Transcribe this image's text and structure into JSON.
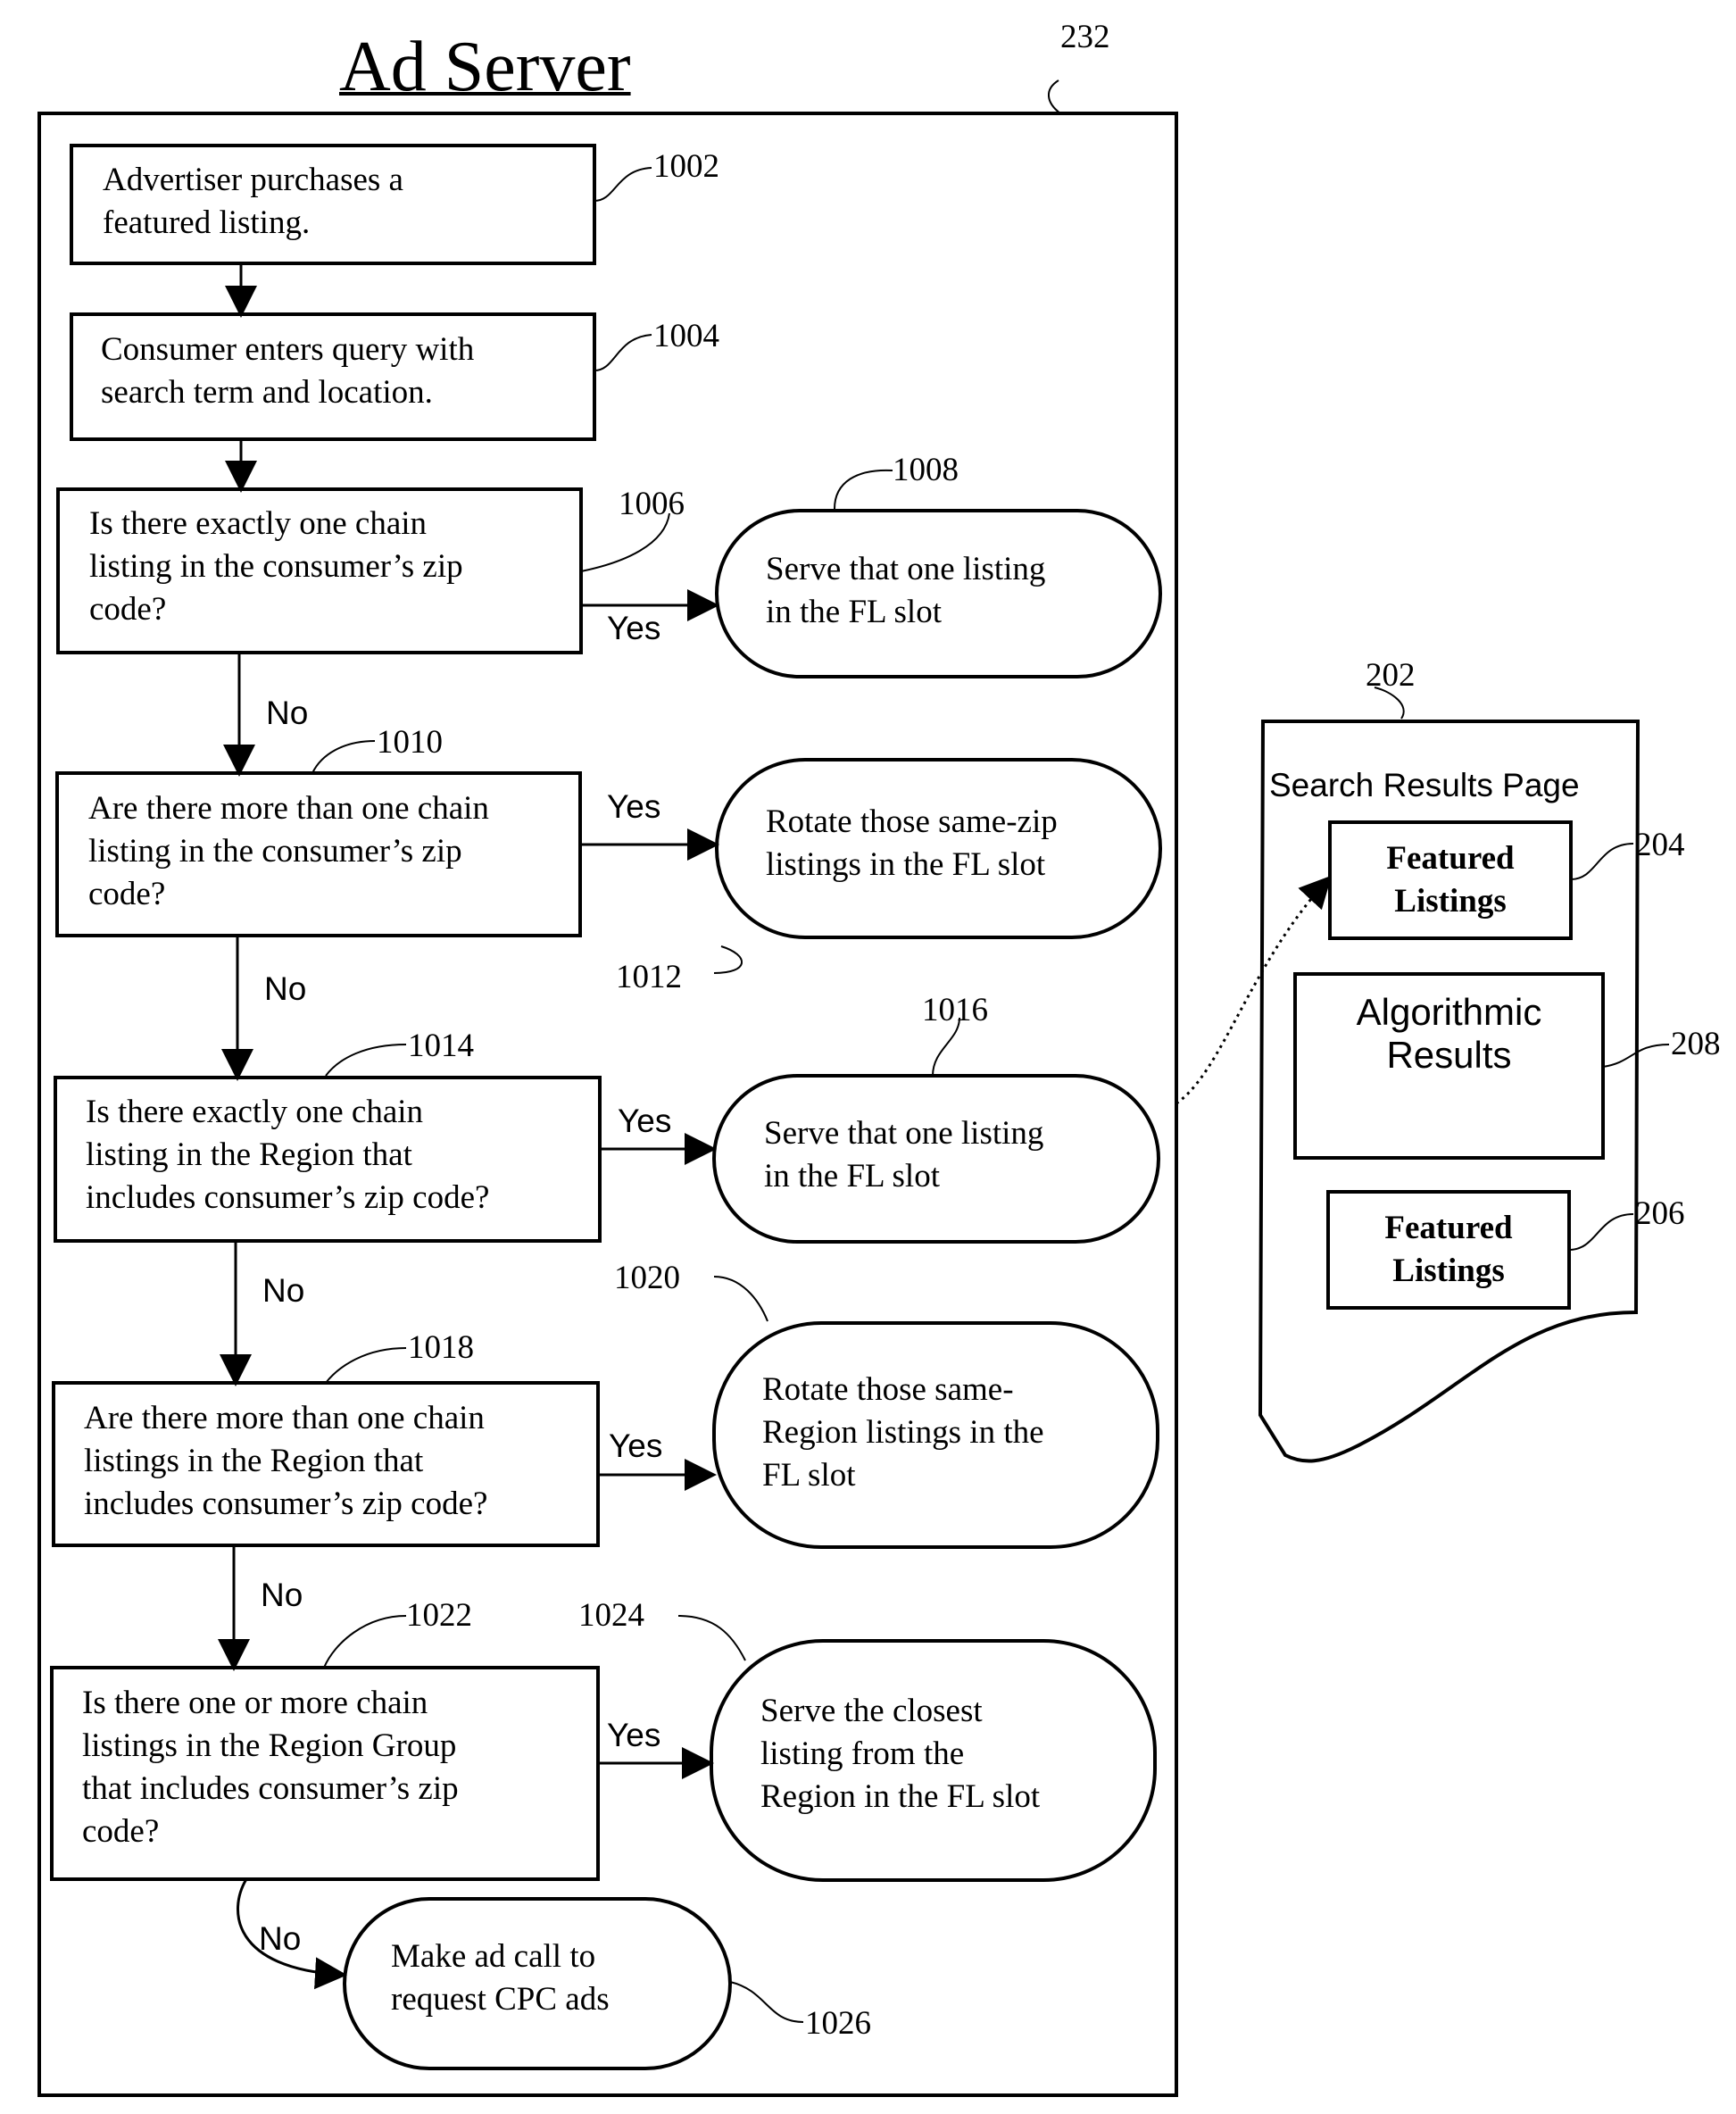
{
  "title": "Ad Server",
  "refs": {
    "server": "232",
    "s1002": "1002",
    "s1004": "1004",
    "s1006": "1006",
    "s1008": "1008",
    "s1010": "1010",
    "s1012": "1012",
    "s1014": "1014",
    "s1016": "1016",
    "s1018": "1018",
    "s1020": "1020",
    "s1022": "1022",
    "s1024": "1024",
    "s1026": "1026",
    "page": "202",
    "fl_top": "204",
    "algo": "208",
    "fl_bottom": "206"
  },
  "steps": {
    "s1002": "Advertiser purchases a\nfeatured listing.",
    "s1004": "Consumer enters query with\nsearch term and location.",
    "s1006": "Is there exactly one chain\nlisting in the consumer’s zip\ncode?",
    "s1008": "Serve that one listing\nin the FL slot",
    "s1010": "Are there more than one chain\nlisting in the consumer’s zip\ncode?",
    "s1012": "Rotate those same-zip\nlistings in the FL slot",
    "s1014": "Is there exactly one chain\nlisting in the Region that\nincludes consumer’s zip code?",
    "s1016": "Serve that one listing\nin the FL slot",
    "s1018": "Are there more than one chain\nlistings in the Region that\nincludes consumer’s zip code?",
    "s1020": "Rotate those same-\nRegion listings in the\nFL slot",
    "s1022": "Is there one or more chain\nlistings in the Region Group\nthat includes consumer’s zip\ncode?",
    "s1024": "Serve the closest\nlisting from the\nRegion in the FL slot",
    "s1026": "Make ad call to\nrequest CPC ads"
  },
  "labels": {
    "yes": "Yes",
    "no": "No"
  },
  "results_page": {
    "title": "Search Results Page",
    "featured_top": "Featured\nListings",
    "algorithmic": "Algorithmic\nResults",
    "featured_bottom": "Featured\nListings"
  }
}
